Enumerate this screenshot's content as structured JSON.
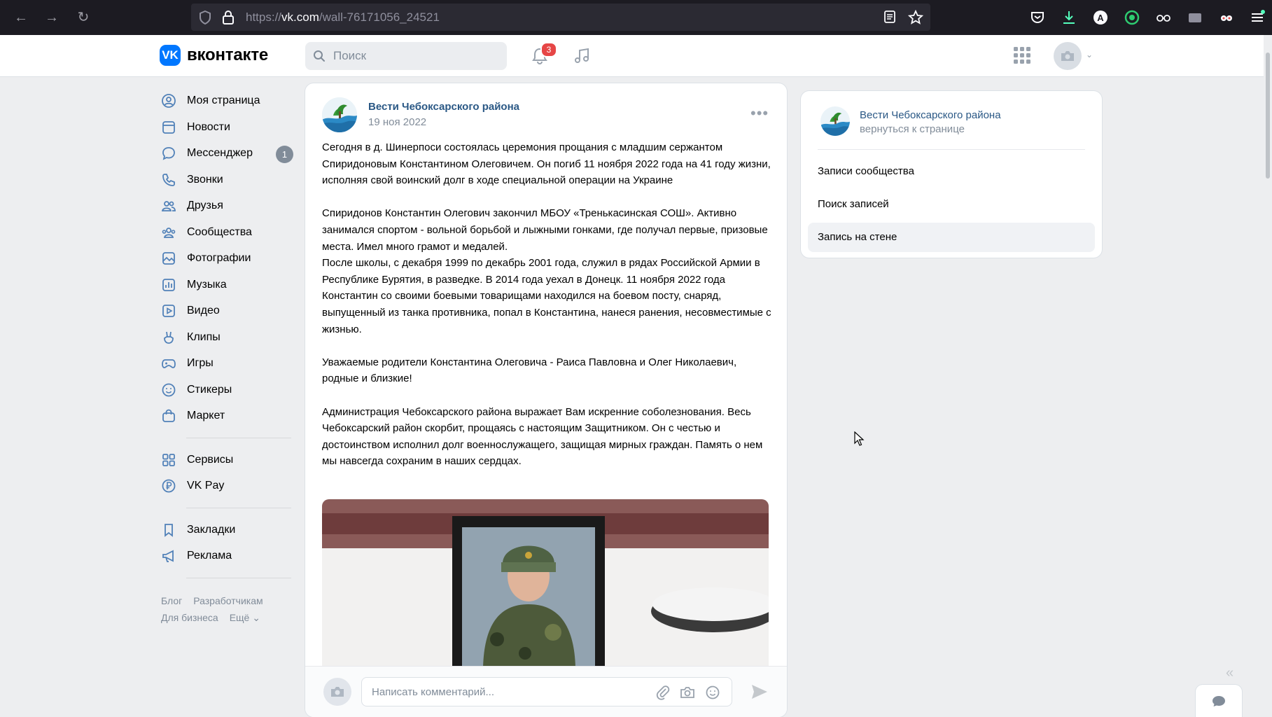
{
  "browser": {
    "url_prefix": "https://",
    "url_domain": "vk.com",
    "url_path": "/wall-76171056_24521"
  },
  "header": {
    "brand": "вконтакте",
    "logo_text": "VK",
    "search_placeholder": "Поиск",
    "notifications_count": "3"
  },
  "sidebar": {
    "items": [
      {
        "label": "Моя страница"
      },
      {
        "label": "Новости"
      },
      {
        "label": "Мессенджер",
        "badge": "1"
      },
      {
        "label": "Звонки"
      },
      {
        "label": "Друзья"
      },
      {
        "label": "Сообщества"
      },
      {
        "label": "Фотографии"
      },
      {
        "label": "Музыка"
      },
      {
        "label": "Видео"
      },
      {
        "label": "Клипы"
      },
      {
        "label": "Игры"
      },
      {
        "label": "Стикеры"
      },
      {
        "label": "Маркет"
      }
    ],
    "services": [
      {
        "label": "Сервисы"
      },
      {
        "label": "VK Pay"
      }
    ],
    "extras": [
      {
        "label": "Закладки"
      },
      {
        "label": "Реклама"
      }
    ],
    "footer": [
      "Блог",
      "Разработчикам",
      "Для бизнеса",
      "Ещё"
    ]
  },
  "post": {
    "author": "Вести Чебоксарского района",
    "date": "19 ноя 2022",
    "paragraphs": [
      "Сегодня в д. Шинерпоси состоялась церемония прощания с младшим сержантом Спиридоновым Константином Олеговичем. Он погиб 11 ноября 2022 года на 41 году жизни, исполняя свой воинский долг в ходе специальной операции на Украине",
      "Спиридонов Константин Олегович закончил МБОУ «Тренькасинская СОШ». Активно занимался спортом - вольной борьбой и лыжными гонками, где получал первые, призовые места. Имел много грамот и медалей.",
      "После школы, с декабря 1999 по декабрь 2001 года, служил в рядах Российской Армии в Республике Бурятия, в разведке. В 2014 года уехал в Донецк. 11 ноября 2022 года Константин со своими боевыми товарищами находился на боевом посту, снаряд, выпущенный из танка противника, попал в Константина, нанеся ранения, несовместимые с жизнью.",
      "Уважаемые родители Константина Олеговича - Раиса Павловна и Олег Николаевич,  родные и близкие!",
      "Администрация Чебоксарского района выражает Вам искренние соболезнования. Весь Чебоксарский район скорбит, прощаясь с настоящим Защитником. Он с честью и достоинством исполнил долг военнослужащего, защищая мирных граждан. Память о нем мы навсегда сохраним в наших сердцах."
    ],
    "comment_placeholder": "Написать комментарий..."
  },
  "right_panel": {
    "community": "Вести Чебоксарского района",
    "back_link": "вернуться к странице",
    "items": [
      {
        "label": "Записи сообщества"
      },
      {
        "label": "Поиск записей"
      },
      {
        "label": "Запись на стене"
      }
    ]
  },
  "colors": {
    "accent": "#0077ff",
    "link": "#2a5885",
    "muted": "#818c99",
    "badge": "#e64646"
  }
}
